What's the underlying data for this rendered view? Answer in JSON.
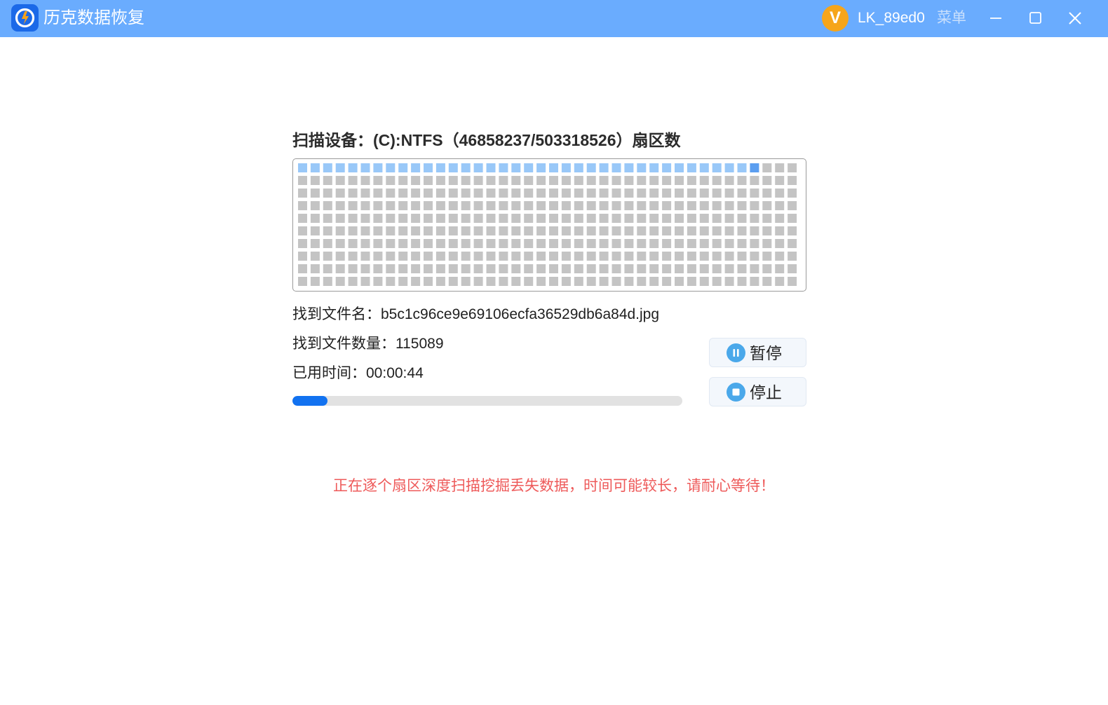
{
  "window": {
    "app_title": "历克数据恢复",
    "user_initial": "V",
    "username": "LK_89ed0",
    "menu_label": "菜单",
    "logo_icon": "app-logo-icon",
    "controls": [
      "minimize-icon",
      "maximize-icon",
      "close-icon"
    ]
  },
  "scan": {
    "heading": "扫描设备：(C):NTFS（46858237/503318526）扇区数",
    "sector_map": {
      "columns": 40,
      "rows": 10,
      "scanned_blocks": 36,
      "current_block": 37,
      "colors": {
        "scanned": "#99c8f8",
        "current": "#5b9ef0",
        "pending": "#c4c4c4"
      }
    },
    "found_file_label": "找到文件名：",
    "found_file_value": "b5c1c96ce9e69106ecfa36529db6a84d.jpg",
    "file_count_label": "找到文件数量：",
    "file_count_value": "115089",
    "elapsed_label": "已用时间：",
    "elapsed_value": "00:00:44",
    "progress": 0.09,
    "pause_label": "暂停",
    "stop_label": "停止"
  },
  "notice": "正在逐个扇区深度扫描挖掘丢失数据，时间可能较长，请耐心等待！",
  "colors": {
    "titlebar": "#6aacfe",
    "accent": "#1272f0",
    "notice": "#ee5a5a",
    "avatar": "#f6a51a"
  }
}
